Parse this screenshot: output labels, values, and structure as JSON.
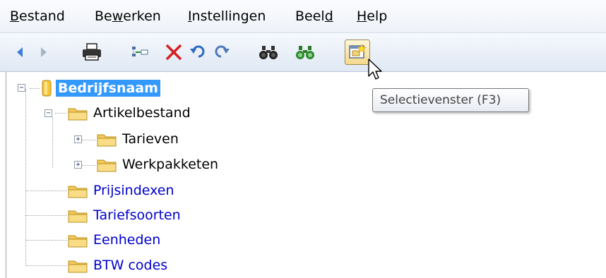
{
  "menubar": {
    "items": [
      {
        "label_pre": "",
        "label_mn": "B",
        "label_post": "estand"
      },
      {
        "label_pre": "Be",
        "label_mn": "w",
        "label_post": "erken"
      },
      {
        "label_pre": "",
        "label_mn": "I",
        "label_post": "nstellingen"
      },
      {
        "label_pre": "Beel",
        "label_mn": "d",
        "label_post": ""
      },
      {
        "label_pre": "",
        "label_mn": "H",
        "label_post": "elp"
      }
    ]
  },
  "toolbar": {
    "buttons": [
      {
        "icon": "back-arrow-icon"
      },
      {
        "icon": "forward-arrow-icon"
      },
      {
        "icon": "printer-icon"
      },
      {
        "icon": "insert-item-icon"
      },
      {
        "icon": "delete-x-icon"
      },
      {
        "icon": "undo-icon"
      },
      {
        "icon": "redo-icon"
      },
      {
        "icon": "find-binoculars-icon"
      },
      {
        "icon": "find-next-binoculars-icon"
      },
      {
        "icon": "selection-window-icon"
      }
    ]
  },
  "tree": {
    "root": {
      "label": "Bedrijfsnaam"
    },
    "artikelbestand": {
      "label": "Artikelbestand"
    },
    "tarieven": {
      "label": "Tarieven"
    },
    "werkpakketen": {
      "label": "Werkpakketen"
    },
    "prijsindexen": {
      "label": "Prijsindexen"
    },
    "tariefsoorten": {
      "label": "Tariefsoorten"
    },
    "eenheden": {
      "label": "Eenheden"
    },
    "btw": {
      "label": "BTW codes"
    }
  },
  "tooltip": {
    "text": "Selectievenster (F3)"
  },
  "colors": {
    "selected_bg": "#3399ff",
    "link_blue": "#0000cc",
    "folder": "#f4c85a"
  }
}
